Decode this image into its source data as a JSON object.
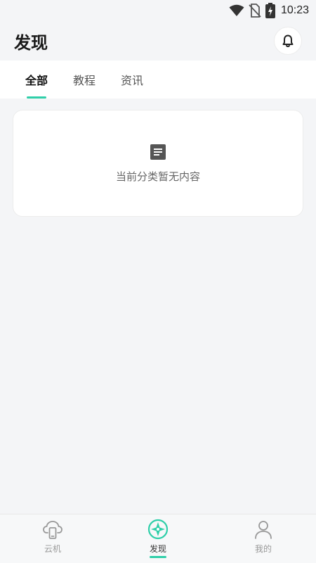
{
  "status_bar": {
    "time": "10:23",
    "icons": [
      "wifi-icon",
      "no-sim-icon",
      "battery-charging-icon"
    ]
  },
  "header": {
    "title": "发现",
    "bell_icon": "bell-icon"
  },
  "tabs": [
    {
      "label": "全部",
      "active": true
    },
    {
      "label": "教程",
      "active": false
    },
    {
      "label": "资讯",
      "active": false
    }
  ],
  "empty_state": {
    "icon": "document-icon",
    "text": "当前分类暂无内容"
  },
  "bottom_nav": [
    {
      "label": "云机",
      "icon": "cloud-phone-icon",
      "active": false
    },
    {
      "label": "发现",
      "icon": "compass-icon",
      "active": true
    },
    {
      "label": "我的",
      "icon": "user-icon",
      "active": false
    }
  ],
  "colors": {
    "accent": "#2fcfa9",
    "background": "#f4f5f7",
    "card": "#ffffff"
  }
}
